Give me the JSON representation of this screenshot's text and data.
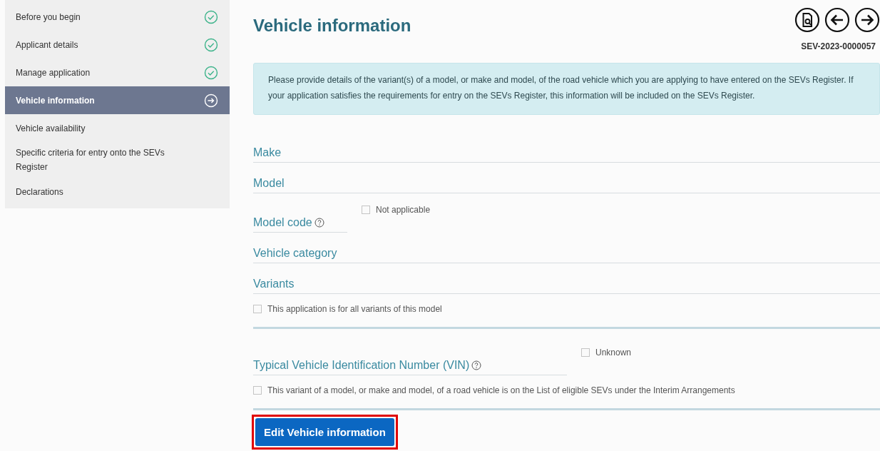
{
  "sidebar": {
    "items": [
      {
        "label": "Before you begin",
        "selected": false,
        "complete": true
      },
      {
        "label": "Applicant details",
        "selected": false,
        "complete": true
      },
      {
        "label": "Manage application",
        "selected": false,
        "complete": true
      },
      {
        "label": "Vehicle information",
        "selected": true,
        "complete": false
      },
      {
        "label": "Vehicle availability",
        "selected": false,
        "complete": false
      },
      {
        "label": "Specific criteria for entry onto the SEVs Register",
        "selected": false,
        "complete": false
      },
      {
        "label": "Declarations",
        "selected": false,
        "complete": false
      }
    ]
  },
  "page": {
    "title": "Vehicle information",
    "reference": "SEV-2023-0000057",
    "info": "Please provide details of the variant(s) of a model, or make and model, of the road vehicle which you are applying to have entered on the SEVs Register. If your application satisfies the requirements for entry on the SEVs Register, this information will be included on the SEVs Register."
  },
  "fields": [
    {
      "kind": "text",
      "label": "Make"
    },
    {
      "kind": "text",
      "label": "Model"
    },
    {
      "kind": "short",
      "label": "Model code",
      "help": true,
      "option": {
        "label": "Not applicable",
        "checked": false
      }
    },
    {
      "kind": "text",
      "label": "Vehicle category"
    },
    {
      "kind": "text",
      "label": "Variants"
    },
    {
      "kind": "checkbox",
      "label": "This application is for all variants of this model",
      "checked": false
    },
    {
      "kind": "divider"
    },
    {
      "kind": "long",
      "label": "Typical Vehicle Identification Number (VIN)",
      "help": true,
      "option": {
        "label": "Unknown",
        "checked": false
      }
    },
    {
      "kind": "checkbox",
      "label": "This variant of a model, or make and model, of a road vehicle is on the List of eligible SEVs under the Interim Arrangements",
      "checked": false
    },
    {
      "kind": "divider"
    }
  ],
  "edit_button": {
    "label": "Edit Vehicle information",
    "highlighted": true
  }
}
